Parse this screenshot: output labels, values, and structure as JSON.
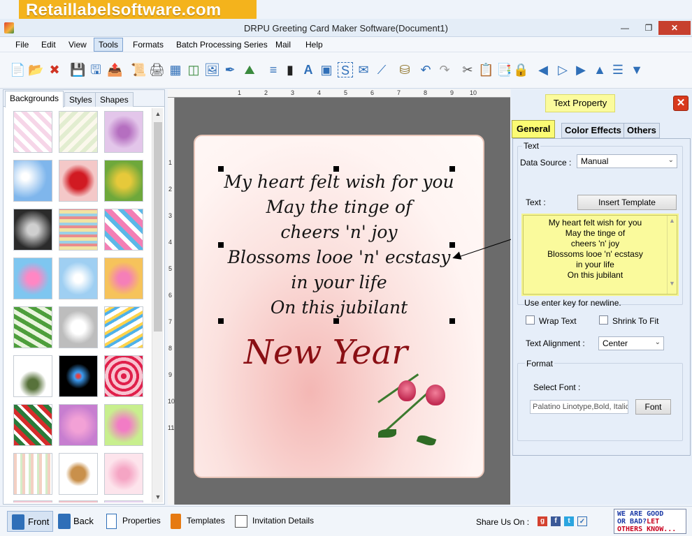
{
  "brand": "Retaillabelsoftware.com",
  "window": {
    "title": "DRPU Greeting Card Maker Software(Document1)"
  },
  "menu": [
    "File",
    "Edit",
    "View",
    "Tools",
    "Formats",
    "Batch Processing Series",
    "Mail",
    "Help"
  ],
  "menu_active": "Tools",
  "left_tabs": [
    "Backgrounds",
    "Styles",
    "Shapes"
  ],
  "card": {
    "lines": [
      "My heart felt wish for you",
      "May the tinge of",
      "cheers 'n' joy",
      "Blossoms looe 'n' ecstasy",
      "in your life",
      "On this jubilant"
    ],
    "headline": "New Year"
  },
  "ruler": {
    "top": [
      "1",
      "2",
      "3",
      "4",
      "5",
      "6",
      "7",
      "8",
      "9",
      "10"
    ],
    "left": [
      "1",
      "2",
      "3",
      "4",
      "5",
      "6",
      "7",
      "8",
      "9",
      "10",
      "11"
    ]
  },
  "right_panel": {
    "title": "Text Property",
    "tabs": [
      "General",
      "Color Effects",
      "Others"
    ],
    "text_group": "Text",
    "data_source_label": "Data Source :",
    "data_source_value": "Manual",
    "text_label": "Text :",
    "insert_template": "Insert Template",
    "text_lines": [
      "My heart felt wish for you",
      "May the tinge of",
      "cheers 'n' joy",
      "Blossoms looe 'n' ecstasy",
      "in your life",
      "On this jubilant"
    ],
    "hint": "Use enter key for newline.",
    "wrap_text": "Wrap Text",
    "shrink_to_fit": "Shrink To Fit",
    "alignment_label": "Text Alignment :",
    "alignment_value": "Center",
    "format_group": "Format",
    "select_font_label": "Select Font :",
    "font_value": "Palatino Linotype,Bold, Italic",
    "font_button": "Font"
  },
  "bottom": {
    "front": "Front",
    "back": "Back",
    "properties": "Properties",
    "templates": "Templates",
    "invitation": "Invitation Details",
    "share_label": "Share Us On :",
    "feedback_1": "WE ARE GOOD",
    "feedback_2a": "OR BAD?",
    "feedback_2b": "LET",
    "feedback_3": "OTHERS KNOW..."
  },
  "colors": {
    "accent": "#2f6fb8",
    "headline": "#8a0f14",
    "panel_highlight": "#fbfb73"
  }
}
